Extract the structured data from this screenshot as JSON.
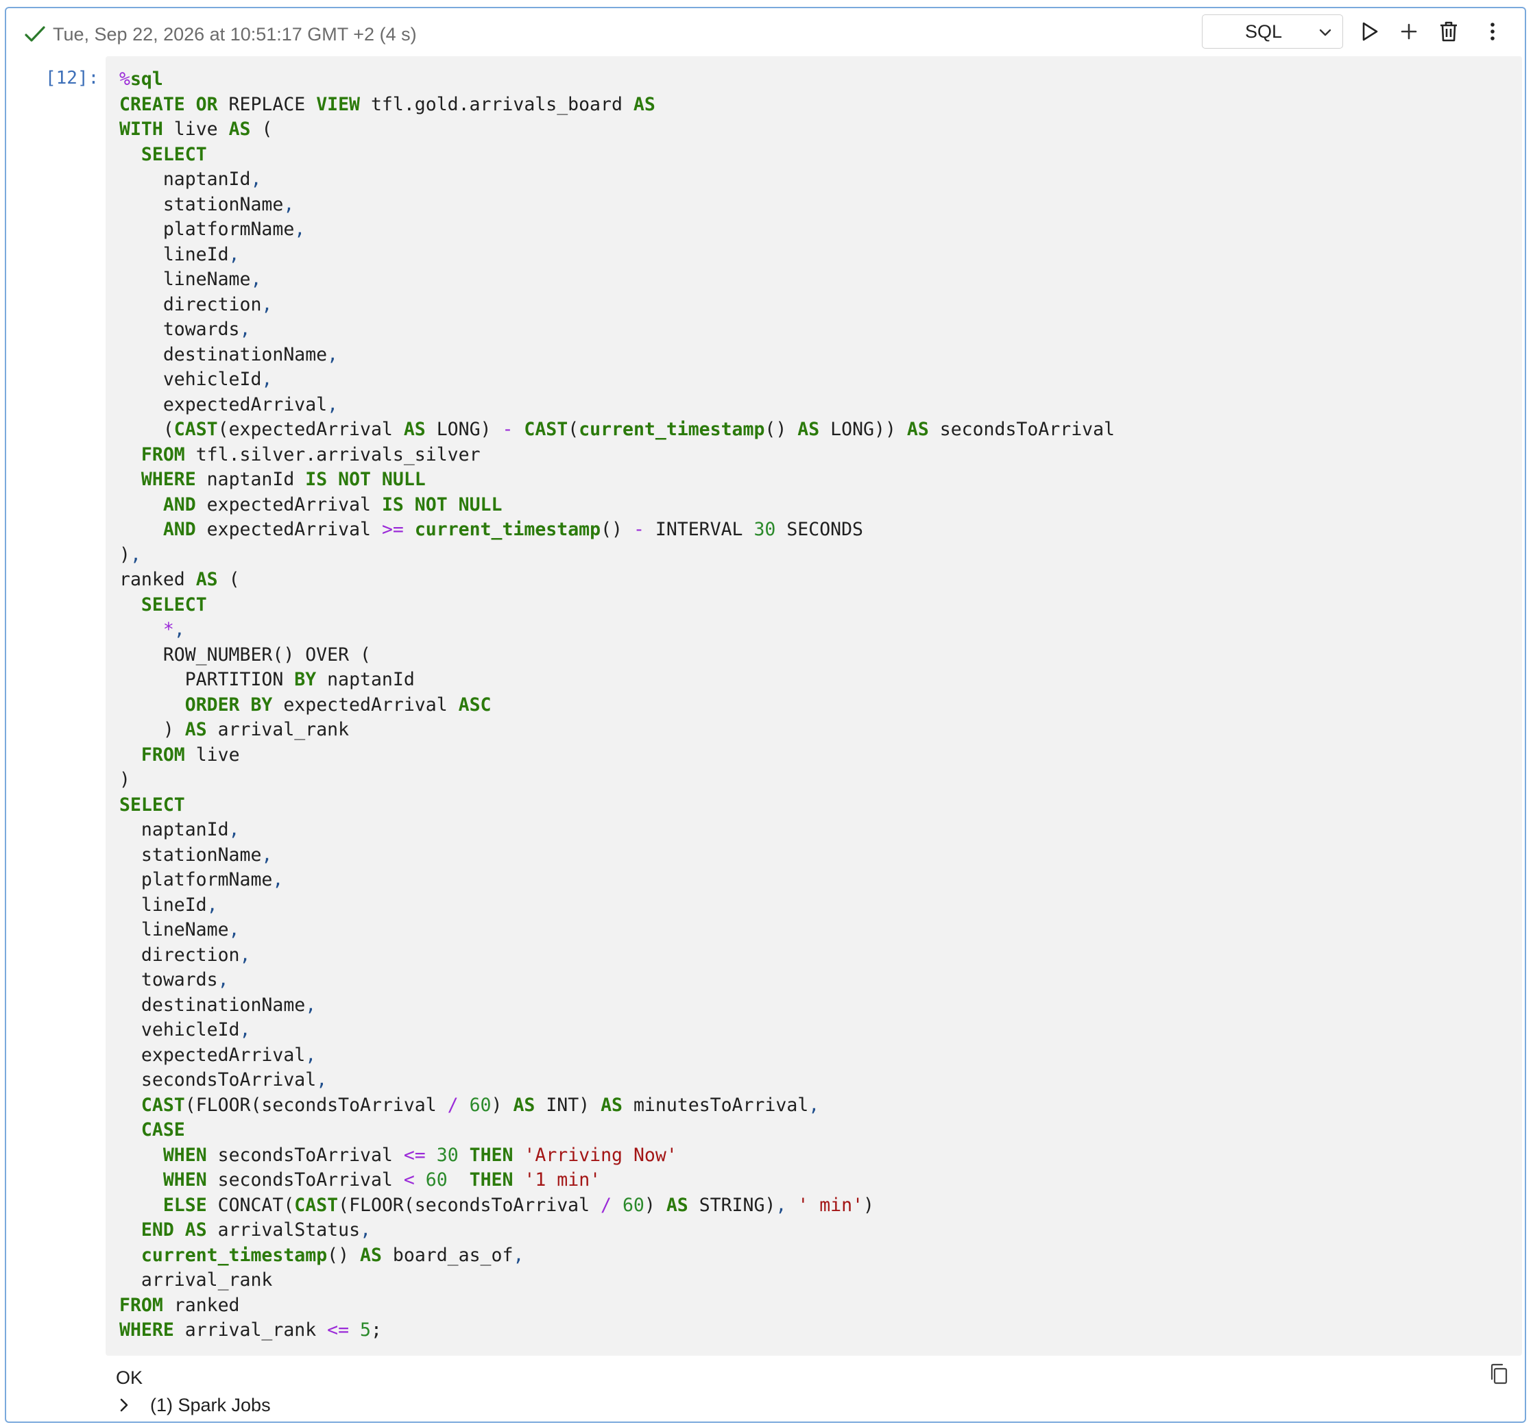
{
  "cell": {
    "status_text": "Tue, Sep 22, 2026 at 10:51:17 GMT +2 (4 s)",
    "language": "SQL",
    "prompt": "[12]:",
    "output_text": "OK",
    "spark_jobs_label": "(1) Spark Jobs"
  },
  "toolbar": {
    "run_icon": "play-icon",
    "add_icon": "plus-icon",
    "delete_icon": "trash-icon",
    "more_icon": "kebab-menu-icon"
  },
  "colors": {
    "keyword": "#2b7a0b",
    "magic": "#9b2bd8",
    "punctuation": "#1f4e8c",
    "number": "#2b8a2b",
    "string": "#a31515",
    "cell_border": "#7aa9dc",
    "editor_bg": "#f2f2f2"
  },
  "code_lines": [
    [
      [
        "mg",
        "%"
      ],
      [
        "kw",
        "sql"
      ]
    ],
    [
      [
        "kw",
        "CREATE OR"
      ],
      [
        "t",
        " REPLACE "
      ],
      [
        "kw",
        "VIEW"
      ],
      [
        "t",
        " tfl.gold.arrivals_board "
      ],
      [
        "kw",
        "AS"
      ]
    ],
    [
      [
        "kw",
        "WITH"
      ],
      [
        "t",
        " live "
      ],
      [
        "kw",
        "AS"
      ],
      [
        "t",
        " ("
      ]
    ],
    [
      [
        "t",
        "  "
      ],
      [
        "kw",
        "SELECT"
      ]
    ],
    [
      [
        "t",
        "    naptanId"
      ],
      [
        "pu",
        ","
      ]
    ],
    [
      [
        "t",
        "    stationName"
      ],
      [
        "pu",
        ","
      ]
    ],
    [
      [
        "t",
        "    platformName"
      ],
      [
        "pu",
        ","
      ]
    ],
    [
      [
        "t",
        "    lineId"
      ],
      [
        "pu",
        ","
      ]
    ],
    [
      [
        "t",
        "    lineName"
      ],
      [
        "pu",
        ","
      ]
    ],
    [
      [
        "t",
        "    direction"
      ],
      [
        "pu",
        ","
      ]
    ],
    [
      [
        "t",
        "    towards"
      ],
      [
        "pu",
        ","
      ]
    ],
    [
      [
        "t",
        "    destinationName"
      ],
      [
        "pu",
        ","
      ]
    ],
    [
      [
        "t",
        "    vehicleId"
      ],
      [
        "pu",
        ","
      ]
    ],
    [
      [
        "t",
        "    expectedArrival"
      ],
      [
        "pu",
        ","
      ]
    ],
    [
      [
        "t",
        "    ("
      ],
      [
        "kw",
        "CAST"
      ],
      [
        "t",
        "(expectedArrival "
      ],
      [
        "kw",
        "AS"
      ],
      [
        "t",
        " LONG) "
      ],
      [
        "mg",
        "-"
      ],
      [
        "t",
        " "
      ],
      [
        "kw",
        "CAST"
      ],
      [
        "t",
        "("
      ],
      [
        "kw",
        "current_timestamp"
      ],
      [
        "t",
        "() "
      ],
      [
        "kw",
        "AS"
      ],
      [
        "t",
        " LONG)) "
      ],
      [
        "kw",
        "AS"
      ],
      [
        "t",
        " secondsToArrival"
      ]
    ],
    [
      [
        "t",
        "  "
      ],
      [
        "kw",
        "FROM"
      ],
      [
        "t",
        " tfl.silver.arrivals_silver"
      ]
    ],
    [
      [
        "t",
        "  "
      ],
      [
        "kw",
        "WHERE"
      ],
      [
        "t",
        " naptanId "
      ],
      [
        "kw",
        "IS NOT NULL"
      ]
    ],
    [
      [
        "t",
        "    "
      ],
      [
        "kw",
        "AND"
      ],
      [
        "t",
        " expectedArrival "
      ],
      [
        "kw",
        "IS NOT NULL"
      ]
    ],
    [
      [
        "t",
        "    "
      ],
      [
        "kw",
        "AND"
      ],
      [
        "t",
        " expectedArrival "
      ],
      [
        "mg",
        ">="
      ],
      [
        "t",
        " "
      ],
      [
        "kw",
        "current_timestamp"
      ],
      [
        "t",
        "() "
      ],
      [
        "mg",
        "-"
      ],
      [
        "t",
        " INTERVAL "
      ],
      [
        "nu",
        "30"
      ],
      [
        "t",
        " SECONDS"
      ]
    ],
    [
      [
        "t",
        ")"
      ],
      [
        "pu",
        ","
      ]
    ],
    [
      [
        "t",
        "ranked "
      ],
      [
        "kw",
        "AS"
      ],
      [
        "t",
        " ("
      ]
    ],
    [
      [
        "t",
        "  "
      ],
      [
        "kw",
        "SELECT"
      ]
    ],
    [
      [
        "t",
        "    "
      ],
      [
        "mg",
        "*"
      ],
      [
        "pu",
        ","
      ]
    ],
    [
      [
        "t",
        "    ROW_NUMBER() OVER ("
      ]
    ],
    [
      [
        "t",
        "      PARTITION "
      ],
      [
        "kw",
        "BY"
      ],
      [
        "t",
        " naptanId"
      ]
    ],
    [
      [
        "t",
        "      "
      ],
      [
        "kw",
        "ORDER BY"
      ],
      [
        "t",
        " expectedArrival "
      ],
      [
        "kw",
        "ASC"
      ]
    ],
    [
      [
        "t",
        "    ) "
      ],
      [
        "kw",
        "AS"
      ],
      [
        "t",
        " arrival_rank"
      ]
    ],
    [
      [
        "t",
        "  "
      ],
      [
        "kw",
        "FROM"
      ],
      [
        "t",
        " live"
      ]
    ],
    [
      [
        "t",
        ")"
      ]
    ],
    [
      [
        "kw",
        "SELECT"
      ]
    ],
    [
      [
        "t",
        "  naptanId"
      ],
      [
        "pu",
        ","
      ]
    ],
    [
      [
        "t",
        "  stationName"
      ],
      [
        "pu",
        ","
      ]
    ],
    [
      [
        "t",
        "  platformName"
      ],
      [
        "pu",
        ","
      ]
    ],
    [
      [
        "t",
        "  lineId"
      ],
      [
        "pu",
        ","
      ]
    ],
    [
      [
        "t",
        "  lineName"
      ],
      [
        "pu",
        ","
      ]
    ],
    [
      [
        "t",
        "  direction"
      ],
      [
        "pu",
        ","
      ]
    ],
    [
      [
        "t",
        "  towards"
      ],
      [
        "pu",
        ","
      ]
    ],
    [
      [
        "t",
        "  destinationName"
      ],
      [
        "pu",
        ","
      ]
    ],
    [
      [
        "t",
        "  vehicleId"
      ],
      [
        "pu",
        ","
      ]
    ],
    [
      [
        "t",
        "  expectedArrival"
      ],
      [
        "pu",
        ","
      ]
    ],
    [
      [
        "t",
        "  secondsToArrival"
      ],
      [
        "pu",
        ","
      ]
    ],
    [
      [
        "t",
        "  "
      ],
      [
        "kw",
        "CAST"
      ],
      [
        "t",
        "(FLOOR(secondsToArrival "
      ],
      [
        "mg",
        "/"
      ],
      [
        "t",
        " "
      ],
      [
        "nu",
        "60"
      ],
      [
        "t",
        ") "
      ],
      [
        "kw",
        "AS"
      ],
      [
        "t",
        " INT) "
      ],
      [
        "kw",
        "AS"
      ],
      [
        "t",
        " minutesToArrival"
      ],
      [
        "pu",
        ","
      ]
    ],
    [
      [
        "t",
        "  "
      ],
      [
        "kw",
        "CASE"
      ]
    ],
    [
      [
        "t",
        "    "
      ],
      [
        "kw",
        "WHEN"
      ],
      [
        "t",
        " secondsToArrival "
      ],
      [
        "mg",
        "<="
      ],
      [
        "t",
        " "
      ],
      [
        "nu",
        "30"
      ],
      [
        "t",
        " "
      ],
      [
        "kw",
        "THEN"
      ],
      [
        "t",
        " "
      ],
      [
        "st",
        "'Arriving Now'"
      ]
    ],
    [
      [
        "t",
        "    "
      ],
      [
        "kw",
        "WHEN"
      ],
      [
        "t",
        " secondsToArrival "
      ],
      [
        "mg",
        "<"
      ],
      [
        "t",
        " "
      ],
      [
        "nu",
        "60"
      ],
      [
        "t",
        "  "
      ],
      [
        "kw",
        "THEN"
      ],
      [
        "t",
        " "
      ],
      [
        "st",
        "'1 min'"
      ]
    ],
    [
      [
        "t",
        "    "
      ],
      [
        "kw",
        "ELSE"
      ],
      [
        "t",
        " CONCAT("
      ],
      [
        "kw",
        "CAST"
      ],
      [
        "t",
        "(FLOOR(secondsToArrival "
      ],
      [
        "mg",
        "/"
      ],
      [
        "t",
        " "
      ],
      [
        "nu",
        "60"
      ],
      [
        "t",
        ") "
      ],
      [
        "kw",
        "AS"
      ],
      [
        "t",
        " STRING)"
      ],
      [
        "pu",
        ","
      ],
      [
        "t",
        " "
      ],
      [
        "st",
        "' min'"
      ],
      [
        "t",
        ")"
      ]
    ],
    [
      [
        "t",
        "  "
      ],
      [
        "kw",
        "END"
      ],
      [
        "t",
        " "
      ],
      [
        "kw",
        "AS"
      ],
      [
        "t",
        " arrivalStatus"
      ],
      [
        "pu",
        ","
      ]
    ],
    [
      [
        "t",
        "  "
      ],
      [
        "kw",
        "current_timestamp"
      ],
      [
        "t",
        "() "
      ],
      [
        "kw",
        "AS"
      ],
      [
        "t",
        " board_as_of"
      ],
      [
        "pu",
        ","
      ]
    ],
    [
      [
        "t",
        "  arrival_rank"
      ]
    ],
    [
      [
        "kw",
        "FROM"
      ],
      [
        "t",
        " ranked"
      ]
    ],
    [
      [
        "kw",
        "WHERE"
      ],
      [
        "t",
        " arrival_rank "
      ],
      [
        "mg",
        "<="
      ],
      [
        "t",
        " "
      ],
      [
        "nu",
        "5"
      ],
      [
        "t",
        ";"
      ]
    ]
  ]
}
